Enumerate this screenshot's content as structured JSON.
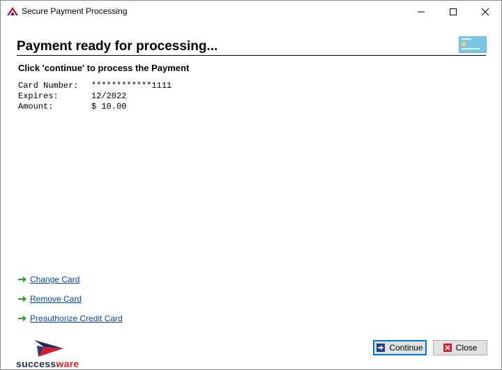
{
  "window": {
    "title": "Secure Payment Processing",
    "icons": {
      "app": "payment-app-icon",
      "minimize": "minimize-icon",
      "maximize": "maximize-icon",
      "close": "close-icon"
    }
  },
  "header": {
    "title": "Payment ready for processing...",
    "instruction": "Click 'continue' to process the Payment",
    "card_image": "credit-card-icon"
  },
  "details": {
    "card_number": {
      "label": "Card Number:",
      "value": "************1111"
    },
    "expires": {
      "label": "Expires:",
      "value": "12/2022"
    },
    "amount": {
      "label": "Amount:",
      "value": "$ 10.00"
    }
  },
  "links": {
    "change_card": "Change Card",
    "remove_card": "Remove Card",
    "preauthorize": "Preauthorize Credit Card"
  },
  "logo": {
    "part1": "success",
    "part2": "ware"
  },
  "buttons": {
    "continue": "Continue",
    "close": "Close"
  },
  "colors": {
    "link": "#0645ad",
    "arrow": "#22a63a",
    "continue_border": "#0078d7",
    "close_icon": "#d21f2b",
    "logo_navy": "#1e2a5a",
    "logo_red": "#d21f2b"
  }
}
